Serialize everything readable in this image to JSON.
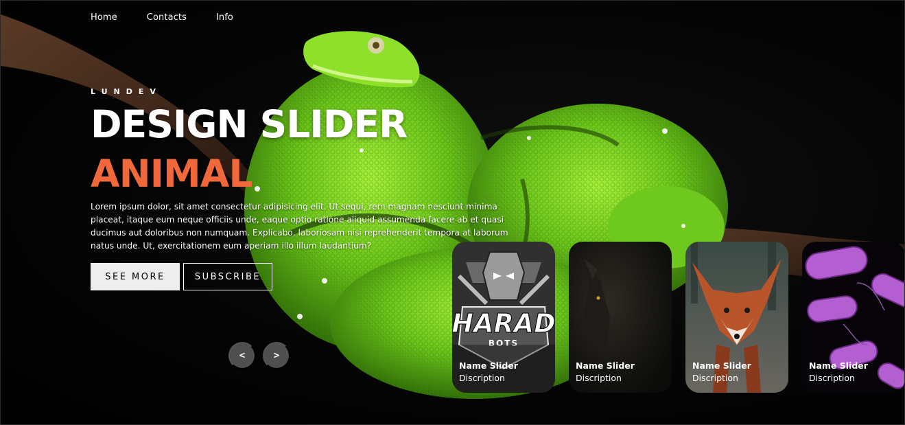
{
  "nav": {
    "items": [
      "Home",
      "Contacts",
      "Info"
    ]
  },
  "slide": {
    "author": "LUNDEV",
    "title": "DESIGN SLIDER",
    "topic": "ANIMAL",
    "description": "Lorem ipsum dolor, sit amet consectetur adipisicing elit. Ut sequi, rem magnam nesciunt minima placeat, itaque eum neque officiis unde, eaque optio ratione aliquid assumenda facere ab et quasi ducimus aut doloribus non numquam. Explicabo, laboriosam nisi reprehenderit tempora at laborum natus unde. Ut, exercitationem eum aperiam illo illum laudantium?",
    "buttons": {
      "see_more": "SEE MORE",
      "subscribe": "SUBSCRIBE"
    }
  },
  "arrows": {
    "prev": "<",
    "next": ">"
  },
  "thumbnails": [
    {
      "title": "Name Slider",
      "description": "Discription",
      "image": "robot-logo-harad-bots",
      "logo_text": "HARAD",
      "logo_sub": "BOTS"
    },
    {
      "title": "Name Slider",
      "description": "Discription",
      "image": "dark-wolf"
    },
    {
      "title": "Name Slider",
      "description": "Discription",
      "image": "red-fox"
    },
    {
      "title": "Name Slider",
      "description": "Discription",
      "image": "purple-bacteria"
    }
  ],
  "colors": {
    "accent": "#f1683a",
    "background": "#000000",
    "snake": "#7fd321",
    "button_light": "#eeeeee",
    "arrow_bg": "#4f4f4f"
  }
}
